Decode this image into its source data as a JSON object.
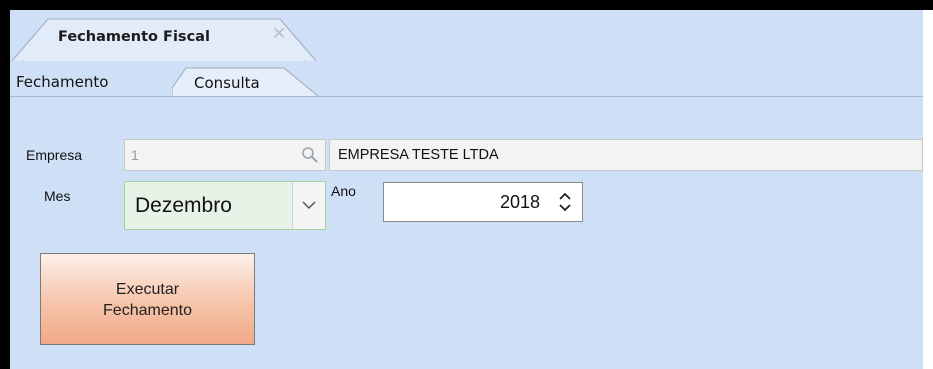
{
  "document_tab": {
    "title": "Fechamento Fiscal",
    "close_glyph": "✕"
  },
  "tabs": [
    {
      "label": "Fechamento",
      "active": true
    },
    {
      "label": "Consulta",
      "active": false
    }
  ],
  "form": {
    "empresa": {
      "label": "Empresa",
      "code": "1",
      "name": "EMPRESA TESTE LTDA"
    },
    "mes": {
      "label": "Mes",
      "value": "Dezembro"
    },
    "ano": {
      "label": "Ano",
      "value": "2018"
    }
  },
  "actions": {
    "executar_line1": "Executar",
    "executar_line2": "Fechamento"
  },
  "colors": {
    "panel_bg": "#cfe0f6",
    "button_accent": "#f1a988",
    "select_focus": "#9fd39f"
  },
  "icons": [
    "close-icon",
    "search-icon",
    "chevron-down-icon",
    "spin-updown-icon"
  ]
}
